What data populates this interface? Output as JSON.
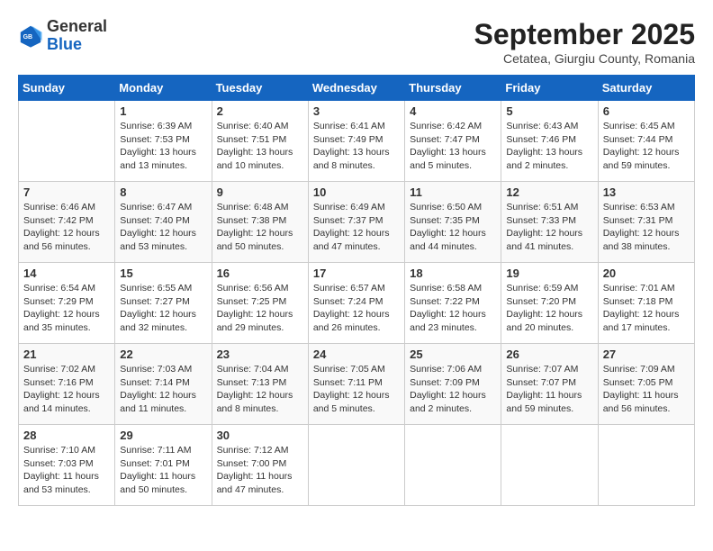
{
  "header": {
    "logo_line1": "General",
    "logo_line2": "Blue",
    "month": "September 2025",
    "location": "Cetatea, Giurgiu County, Romania"
  },
  "days_of_week": [
    "Sunday",
    "Monday",
    "Tuesday",
    "Wednesday",
    "Thursday",
    "Friday",
    "Saturday"
  ],
  "weeks": [
    [
      {
        "day": "",
        "info": ""
      },
      {
        "day": "1",
        "info": "Sunrise: 6:39 AM\nSunset: 7:53 PM\nDaylight: 13 hours\nand 13 minutes."
      },
      {
        "day": "2",
        "info": "Sunrise: 6:40 AM\nSunset: 7:51 PM\nDaylight: 13 hours\nand 10 minutes."
      },
      {
        "day": "3",
        "info": "Sunrise: 6:41 AM\nSunset: 7:49 PM\nDaylight: 13 hours\nand 8 minutes."
      },
      {
        "day": "4",
        "info": "Sunrise: 6:42 AM\nSunset: 7:47 PM\nDaylight: 13 hours\nand 5 minutes."
      },
      {
        "day": "5",
        "info": "Sunrise: 6:43 AM\nSunset: 7:46 PM\nDaylight: 13 hours\nand 2 minutes."
      },
      {
        "day": "6",
        "info": "Sunrise: 6:45 AM\nSunset: 7:44 PM\nDaylight: 12 hours\nand 59 minutes."
      }
    ],
    [
      {
        "day": "7",
        "info": "Sunrise: 6:46 AM\nSunset: 7:42 PM\nDaylight: 12 hours\nand 56 minutes."
      },
      {
        "day": "8",
        "info": "Sunrise: 6:47 AM\nSunset: 7:40 PM\nDaylight: 12 hours\nand 53 minutes."
      },
      {
        "day": "9",
        "info": "Sunrise: 6:48 AM\nSunset: 7:38 PM\nDaylight: 12 hours\nand 50 minutes."
      },
      {
        "day": "10",
        "info": "Sunrise: 6:49 AM\nSunset: 7:37 PM\nDaylight: 12 hours\nand 47 minutes."
      },
      {
        "day": "11",
        "info": "Sunrise: 6:50 AM\nSunset: 7:35 PM\nDaylight: 12 hours\nand 44 minutes."
      },
      {
        "day": "12",
        "info": "Sunrise: 6:51 AM\nSunset: 7:33 PM\nDaylight: 12 hours\nand 41 minutes."
      },
      {
        "day": "13",
        "info": "Sunrise: 6:53 AM\nSunset: 7:31 PM\nDaylight: 12 hours\nand 38 minutes."
      }
    ],
    [
      {
        "day": "14",
        "info": "Sunrise: 6:54 AM\nSunset: 7:29 PM\nDaylight: 12 hours\nand 35 minutes."
      },
      {
        "day": "15",
        "info": "Sunrise: 6:55 AM\nSunset: 7:27 PM\nDaylight: 12 hours\nand 32 minutes."
      },
      {
        "day": "16",
        "info": "Sunrise: 6:56 AM\nSunset: 7:25 PM\nDaylight: 12 hours\nand 29 minutes."
      },
      {
        "day": "17",
        "info": "Sunrise: 6:57 AM\nSunset: 7:24 PM\nDaylight: 12 hours\nand 26 minutes."
      },
      {
        "day": "18",
        "info": "Sunrise: 6:58 AM\nSunset: 7:22 PM\nDaylight: 12 hours\nand 23 minutes."
      },
      {
        "day": "19",
        "info": "Sunrise: 6:59 AM\nSunset: 7:20 PM\nDaylight: 12 hours\nand 20 minutes."
      },
      {
        "day": "20",
        "info": "Sunrise: 7:01 AM\nSunset: 7:18 PM\nDaylight: 12 hours\nand 17 minutes."
      }
    ],
    [
      {
        "day": "21",
        "info": "Sunrise: 7:02 AM\nSunset: 7:16 PM\nDaylight: 12 hours\nand 14 minutes."
      },
      {
        "day": "22",
        "info": "Sunrise: 7:03 AM\nSunset: 7:14 PM\nDaylight: 12 hours\nand 11 minutes."
      },
      {
        "day": "23",
        "info": "Sunrise: 7:04 AM\nSunset: 7:13 PM\nDaylight: 12 hours\nand 8 minutes."
      },
      {
        "day": "24",
        "info": "Sunrise: 7:05 AM\nSunset: 7:11 PM\nDaylight: 12 hours\nand 5 minutes."
      },
      {
        "day": "25",
        "info": "Sunrise: 7:06 AM\nSunset: 7:09 PM\nDaylight: 12 hours\nand 2 minutes."
      },
      {
        "day": "26",
        "info": "Sunrise: 7:07 AM\nSunset: 7:07 PM\nDaylight: 11 hours\nand 59 minutes."
      },
      {
        "day": "27",
        "info": "Sunrise: 7:09 AM\nSunset: 7:05 PM\nDaylight: 11 hours\nand 56 minutes."
      }
    ],
    [
      {
        "day": "28",
        "info": "Sunrise: 7:10 AM\nSunset: 7:03 PM\nDaylight: 11 hours\nand 53 minutes."
      },
      {
        "day": "29",
        "info": "Sunrise: 7:11 AM\nSunset: 7:01 PM\nDaylight: 11 hours\nand 50 minutes."
      },
      {
        "day": "30",
        "info": "Sunrise: 7:12 AM\nSunset: 7:00 PM\nDaylight: 11 hours\nand 47 minutes."
      },
      {
        "day": "",
        "info": ""
      },
      {
        "day": "",
        "info": ""
      },
      {
        "day": "",
        "info": ""
      },
      {
        "day": "",
        "info": ""
      }
    ]
  ]
}
